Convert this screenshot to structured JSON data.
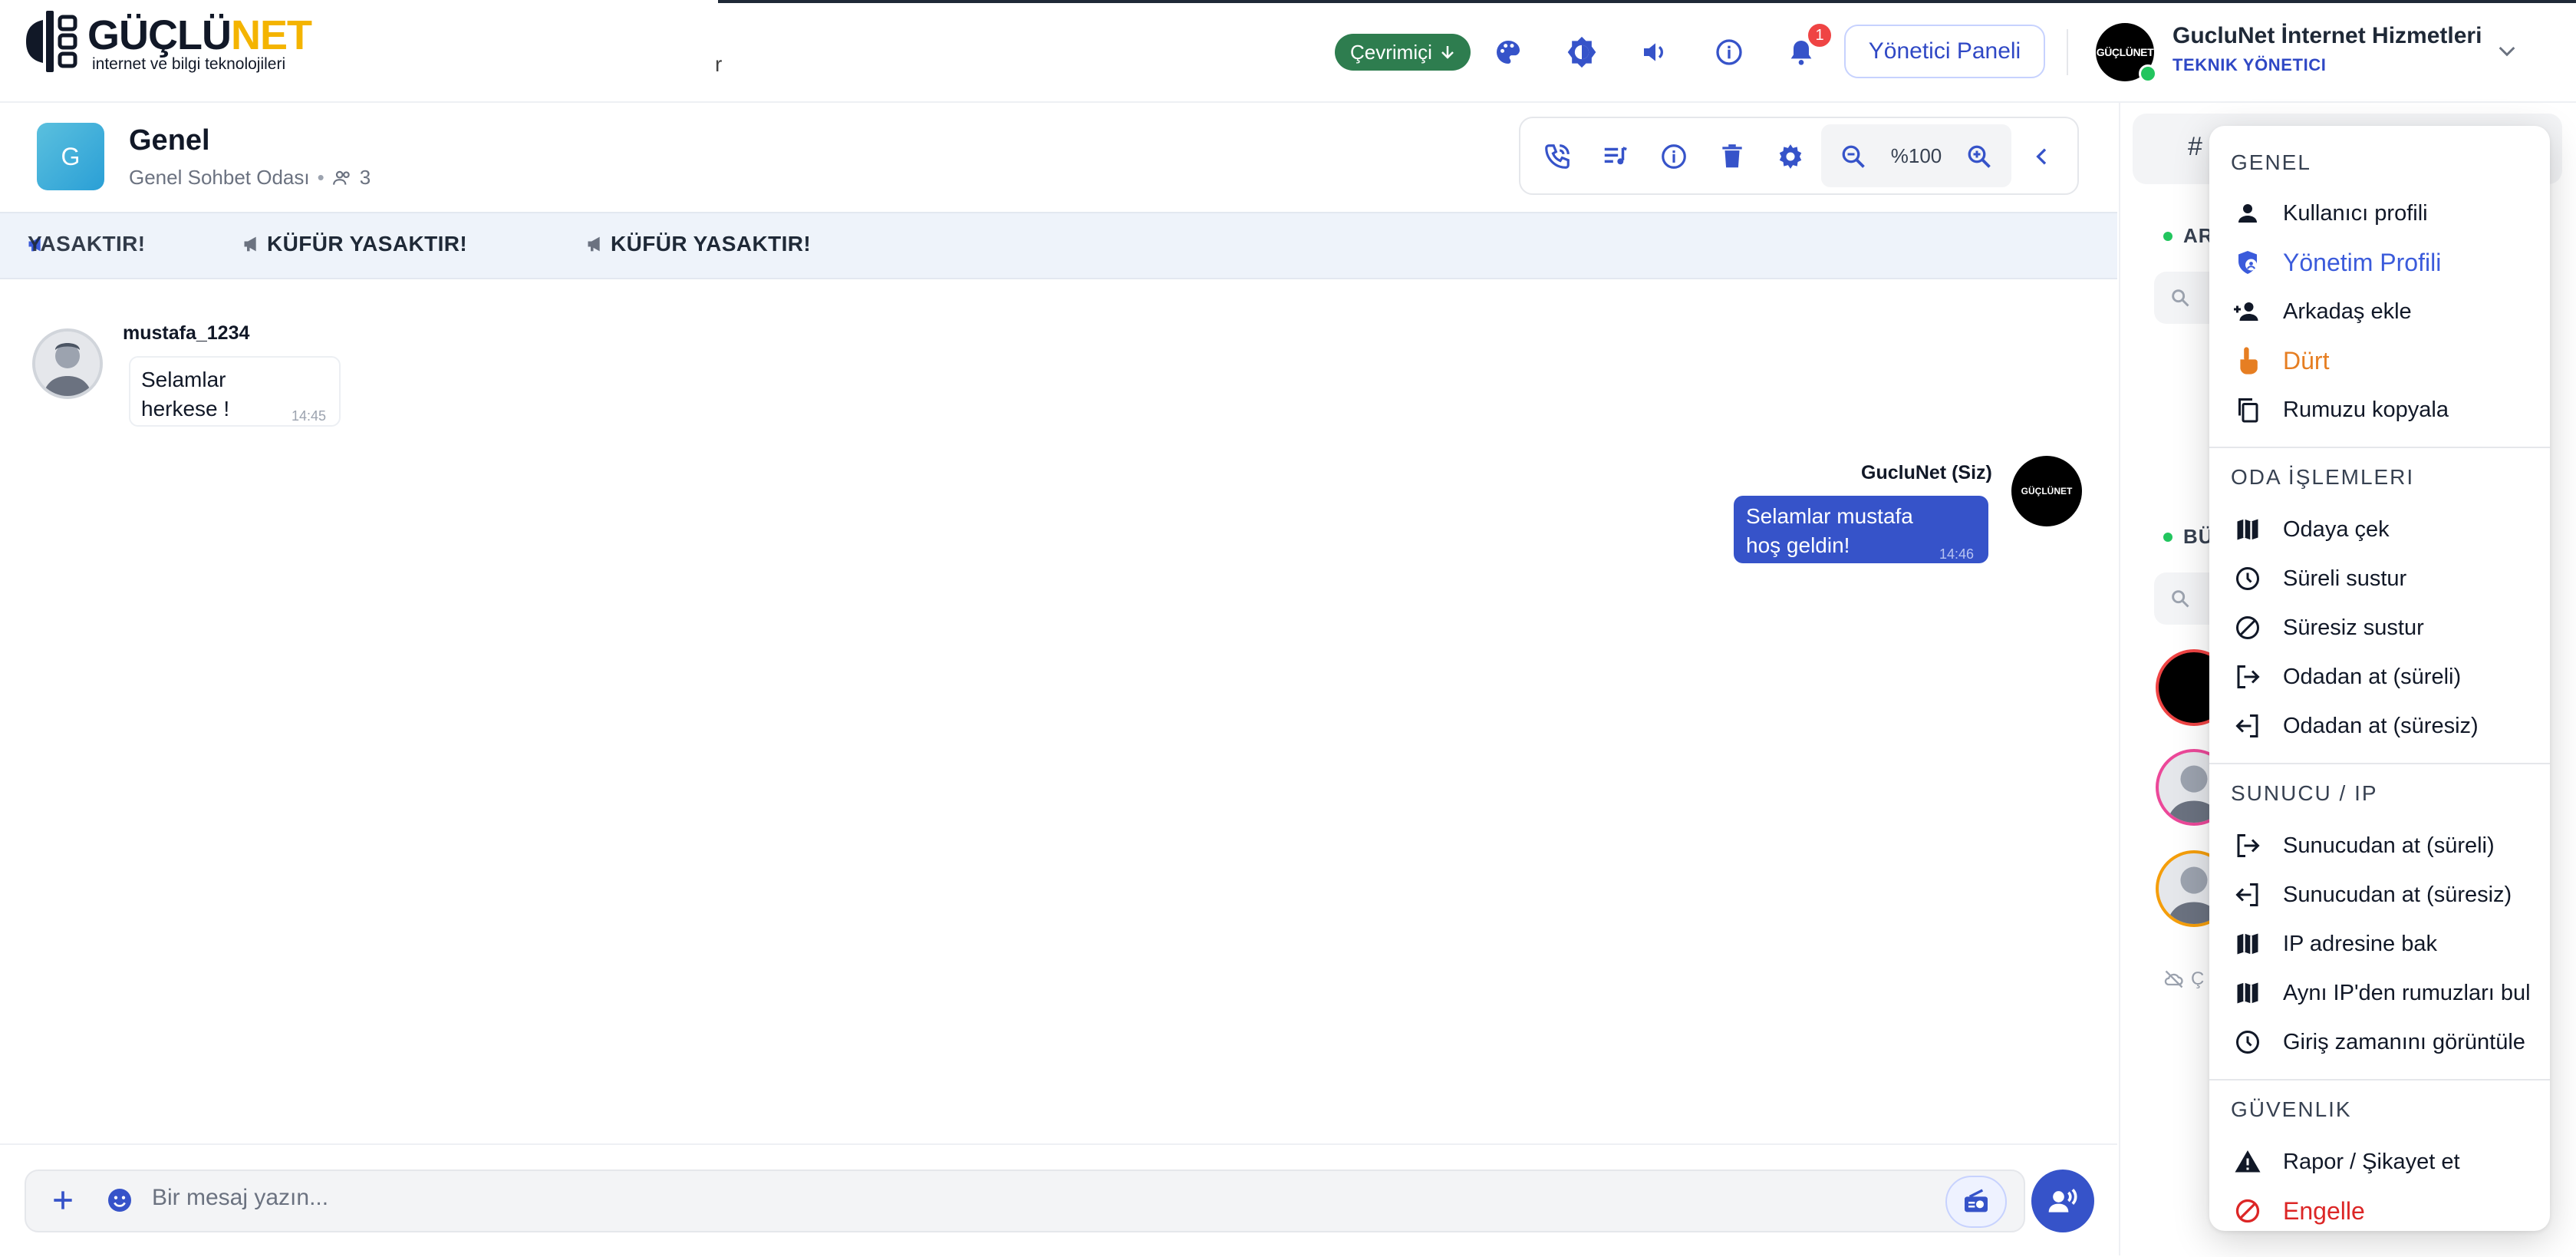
{
  "header": {
    "logo_text_a": "GÜÇLÜ",
    "logo_text_b": "NET",
    "logo_subtitle": "internet ve bilgi teknolojileri",
    "stray_char": "r",
    "status_label": "Çevrimiçi",
    "notification_count": "1",
    "admin_button": "Yönetici Paneli",
    "user_name": "GucluNet İnternet Hizmetleri",
    "user_role": "TEKNIK YÖNETICI",
    "avatar_logo_text": "GÜÇLÜNET"
  },
  "room": {
    "avatar_letter": "G",
    "title": "Genel",
    "subtitle": "Genel Sohbet Odası",
    "member_count": "3",
    "zoom_level": "%100"
  },
  "marquee": {
    "items": [
      "YASAKTIR!",
      "KÜFÜR YASAKTIR!",
      "KÜFÜR YASAKTIR!"
    ]
  },
  "messages": [
    {
      "sender": "mustafa_1234",
      "line1": "Selamlar",
      "line2": "herkese !",
      "time": "14:45",
      "direction": "incoming"
    },
    {
      "sender": "GucluNet (Siz)",
      "line1": "Selamlar mustafa",
      "line2": "hoş geldin!",
      "time": "14:46",
      "direction": "outgoing"
    }
  ],
  "composer": {
    "placeholder": "Bir mesaj yazın..."
  },
  "right_panel": {
    "tab_hash": "#",
    "section1_label": "AR",
    "section2_label": "BÜ",
    "offline_prefix": "Ç"
  },
  "context_menu": {
    "sections": [
      {
        "title": "GENEL",
        "items": [
          {
            "label": "Kullanıcı profili",
            "icon": "person-icon",
            "tone": "default"
          },
          {
            "label": "Yönetim Profili",
            "icon": "shield-person-icon",
            "tone": "blue"
          },
          {
            "label": "Arkadaş ekle",
            "icon": "person-add-icon",
            "tone": "default"
          },
          {
            "label": "Dürt",
            "icon": "poke-hand-icon",
            "tone": "orange"
          },
          {
            "label": "Rumuzu kopyala",
            "icon": "copy-icon",
            "tone": "default"
          }
        ]
      },
      {
        "title": "ODA İŞLEMLERI",
        "items": [
          {
            "label": "Odaya çek",
            "icon": "map-icon",
            "tone": "default"
          },
          {
            "label": "Süreli sustur",
            "icon": "clock-icon",
            "tone": "default"
          },
          {
            "label": "Süresiz sustur",
            "icon": "block-icon",
            "tone": "default"
          },
          {
            "label": "Odadan at (süreli)",
            "icon": "logout-icon",
            "tone": "default"
          },
          {
            "label": "Odadan at (süresiz)",
            "icon": "login-icon",
            "tone": "default"
          }
        ]
      },
      {
        "title": "SUNUCU / IP",
        "items": [
          {
            "label": "Sunucudan at (süreli)",
            "icon": "logout-icon",
            "tone": "default"
          },
          {
            "label": "Sunucudan at (süresiz)",
            "icon": "login-icon",
            "tone": "default"
          },
          {
            "label": "IP adresine bak",
            "icon": "map-icon",
            "tone": "default"
          },
          {
            "label": "Aynı IP'den rumuzları bul",
            "icon": "map-icon",
            "tone": "default"
          },
          {
            "label": "Giriş zamanını görüntüle",
            "icon": "clock-icon",
            "tone": "default"
          }
        ]
      },
      {
        "title": "GÜVENLIK",
        "items": [
          {
            "label": "Rapor / Şikayet et",
            "icon": "warning-icon",
            "tone": "default"
          },
          {
            "label": "Engelle",
            "icon": "block-icon",
            "tone": "red"
          }
        ]
      }
    ]
  },
  "colors": {
    "accent": "#3653c9",
    "online": "#2e7d4f",
    "logo_yellow": "#f4b400",
    "danger": "#dc2626",
    "warning_orange": "#e67e22"
  }
}
